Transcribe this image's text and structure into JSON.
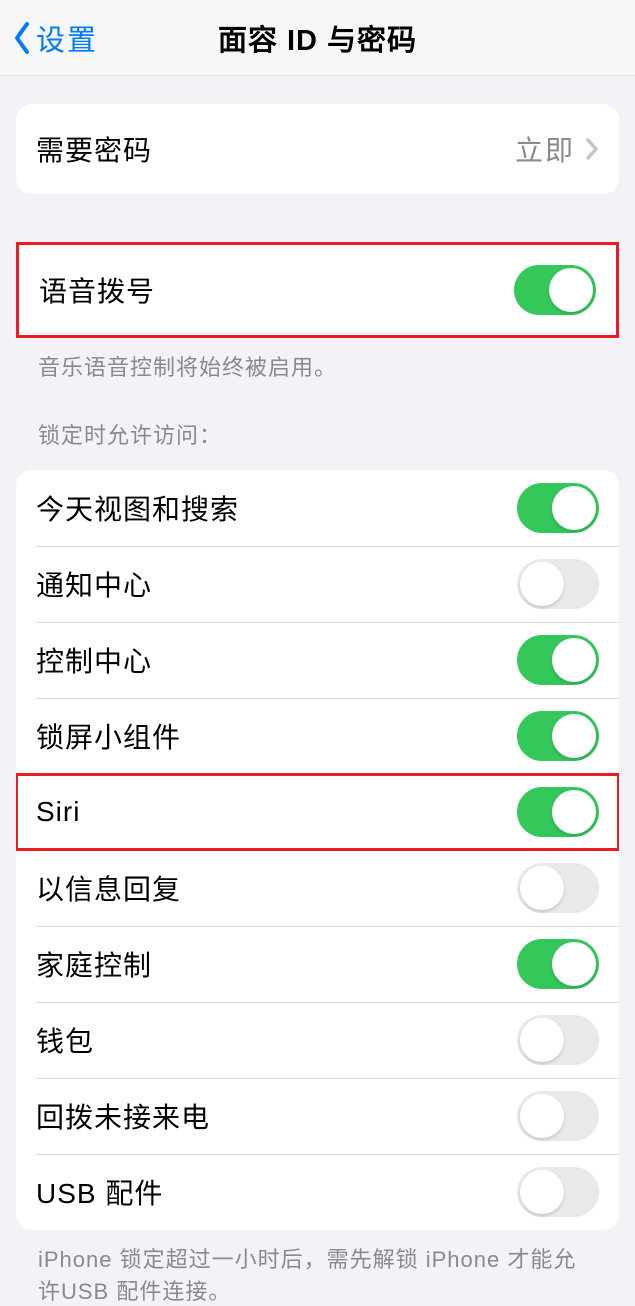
{
  "nav": {
    "back_label": "设置",
    "title": "面容 ID 与密码"
  },
  "require_passcode": {
    "label": "需要密码",
    "value": "立即"
  },
  "voice_dial": {
    "label": "语音拨号",
    "footer": "音乐语音控制将始终被启用。"
  },
  "locked_access": {
    "header": "锁定时允许访问：",
    "items": [
      {
        "label": "今天视图和搜索",
        "on": true
      },
      {
        "label": "通知中心",
        "on": false
      },
      {
        "label": "控制中心",
        "on": true
      },
      {
        "label": "锁屏小组件",
        "on": true
      },
      {
        "label": "Siri",
        "on": true
      },
      {
        "label": "以信息回复",
        "on": false
      },
      {
        "label": "家庭控制",
        "on": true
      },
      {
        "label": "钱包",
        "on": false
      },
      {
        "label": "回拨未接来电",
        "on": false
      },
      {
        "label": "USB 配件",
        "on": false
      }
    ],
    "footer": "iPhone 锁定超过一小时后，需先解锁 iPhone 才能允许USB 配件连接。"
  }
}
